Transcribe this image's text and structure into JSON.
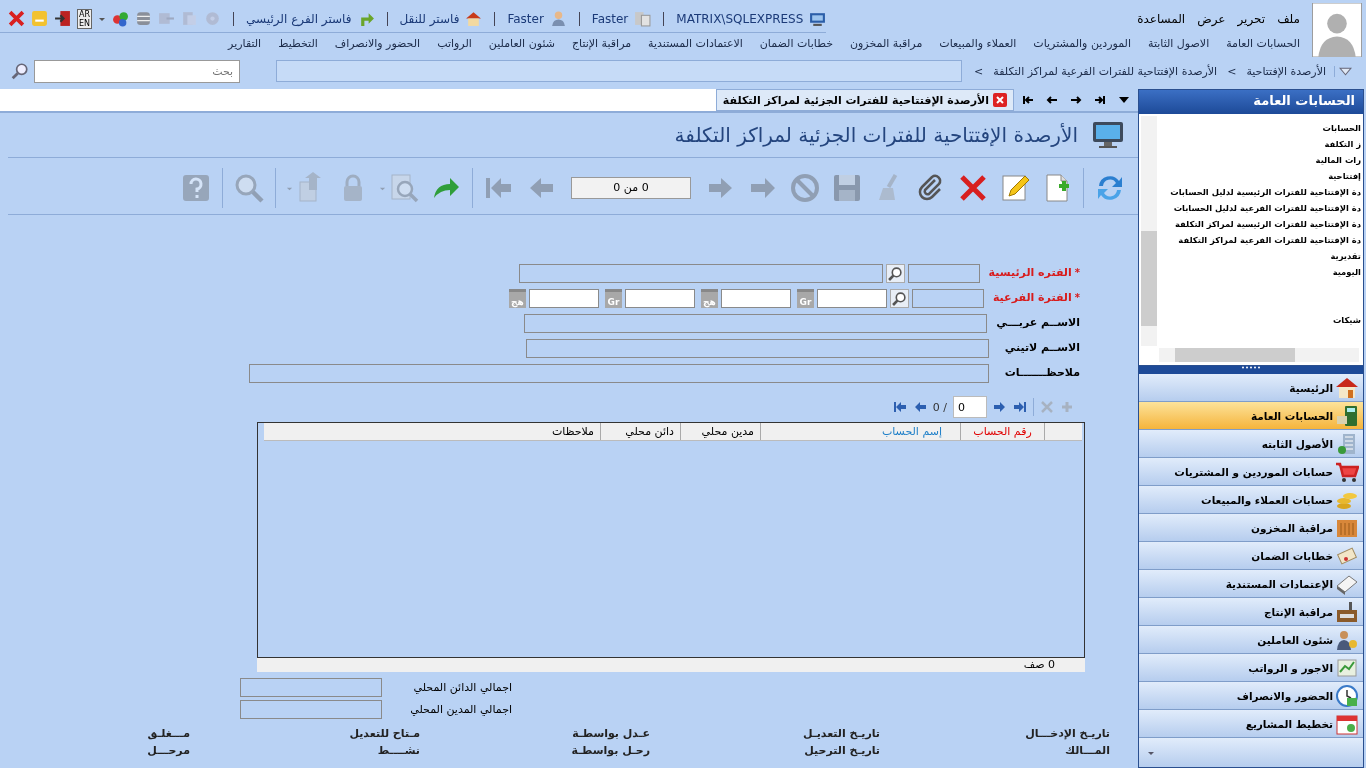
{
  "menu": [
    "ملف",
    "تحرير",
    "عرض",
    "المساعدة"
  ],
  "language": [
    "AR",
    "EN"
  ],
  "connection": [
    {
      "kind": "server",
      "label": "MATRIX\\SQLEXPRESS"
    },
    {
      "kind": "company",
      "label": "Faster"
    },
    {
      "kind": "user",
      "label": "Faster"
    },
    {
      "kind": "home",
      "label": "فاستر للنقل"
    },
    {
      "kind": "branch",
      "label": "فاستر الفرع الرئيسي"
    }
  ],
  "nav": [
    "الحسابات العامة",
    "الاصول الثابتة",
    "الموردين والمشتريات",
    "العملاء والمبيعات",
    "مراقبة المخزون",
    "خطابات الضمان",
    "الاعتمادات المستندية",
    "مراقبة الإنتاج",
    "شئون العاملين",
    "الرواتب",
    "الحضور والانصراف",
    "التخطيط",
    "التقارير"
  ],
  "breadcrumb": {
    "separator": ">",
    "items": [
      "الأرصدة الإفتتاحية",
      "الأرصدة الإفتتاحية للفترات الفرعية لمراكز التكلفة"
    ]
  },
  "search": {
    "placeholder": "بحث"
  },
  "tab": {
    "label": "الأرصدة الإفتتاحية للفترات الجزئية لمراكز التكلفة"
  },
  "form_title": "الأرصدة الإفتتاحية للفترات الجزئية لمراكز التكلفة",
  "tools": [
    {
      "kind": "refresh",
      "disabled": false
    },
    {
      "kind": "separator"
    },
    {
      "kind": "new",
      "disabled": false
    },
    {
      "kind": "edit",
      "disabled": false
    },
    {
      "kind": "delete",
      "disabled": false
    },
    {
      "kind": "attach",
      "disabled": false
    },
    {
      "kind": "clear",
      "disabled": true
    },
    {
      "kind": "save",
      "disabled": true
    },
    {
      "kind": "cancel",
      "disabled": true
    },
    {
      "kind": "last",
      "disabled": true
    },
    {
      "kind": "next",
      "disabled": true
    },
    {
      "kind": "counter",
      "label": "0 من 0"
    },
    {
      "kind": "prev",
      "disabled": true
    },
    {
      "kind": "first",
      "disabled": true
    },
    {
      "kind": "separator"
    },
    {
      "kind": "redo",
      "disabled": false
    },
    {
      "kind": "preview",
      "disabled": true
    },
    {
      "kind": "lock",
      "disabled": true
    },
    {
      "kind": "export",
      "disabled": true
    },
    {
      "kind": "separator"
    },
    {
      "kind": "find",
      "disabled": true
    },
    {
      "kind": "separator"
    },
    {
      "kind": "help",
      "disabled": true
    }
  ],
  "required_mark": "*",
  "fields": [
    {
      "kind": "lookup",
      "label": "الفتره الرئيسية",
      "required": true
    },
    {
      "kind": "dates",
      "label": "الفترة الفرعية",
      "required": true,
      "dates": [
        {
          "badge": "Gr"
        },
        {
          "badge": "هج"
        },
        {
          "badge": "Gr"
        },
        {
          "badge": "هج"
        }
      ]
    },
    {
      "kind": "text",
      "label": "الاســم عربـــي",
      "required": false
    },
    {
      "kind": "text",
      "label": "الاســم لاتيني",
      "required": false
    },
    {
      "kind": "wide",
      "label": "ملاحظـــــــات",
      "required": false
    }
  ],
  "pager": {
    "value": "0",
    "total": "/ 0"
  },
  "grid": {
    "columns": [
      {
        "label": "رقم الحساب",
        "color": "#e00000"
      },
      {
        "label": "إسم الحساب",
        "color": "#1e7fc8"
      },
      {
        "label": "مدين محلي",
        "color": "#000000"
      },
      {
        "label": "دائن محلي",
        "color": "#000000"
      },
      {
        "label": "ملاحظات",
        "color": "#000000"
      }
    ],
    "footer": "0 صف"
  },
  "totals": [
    "اجمالي الدائن المحلي",
    "اجمالي المدين المحلي"
  ],
  "audit": [
    [
      "تاريـخ الإدخـــال",
      "تاريـخ التعديـل",
      "عـدل بواسطـة",
      "مـتاح للتعديل",
      "مـــغلـق"
    ],
    [
      "المـــالك",
      "تاريـخ الترحيل",
      "رحـل بواسطـة",
      "نشــــط",
      "مرحـــل"
    ]
  ],
  "sidebar": {
    "title": "الحسابات العامة",
    "tree": [
      "الحسابات",
      "ز التكلفة",
      "رات المالية",
      "إفتتاحية",
      "دة الإفتتاحية للفترات الرئيسية لدليل الحسابات",
      "دة الإفتتاحية للفترات الفرعية لدليل الحسابات",
      "دة الإفتتاحية للفترات الرئيسية لمراكز التكلفة",
      "دة الإفتتاحية للفترات الفرعية لمراكز التكلفة",
      "تقديرية",
      "اليومية",
      "شيكات"
    ],
    "modules": [
      {
        "kind": "house",
        "label": "الرئيسية",
        "selected": false
      },
      {
        "kind": "calculator",
        "label": "الحسابات العامة",
        "selected": true
      },
      {
        "kind": "building",
        "label": "الأصول الثابته",
        "selected": false
      },
      {
        "kind": "cart",
        "label": "حسابات الموردين و المشتريات",
        "selected": false
      },
      {
        "kind": "coins",
        "label": "حسابات العملاء والمبيعات",
        "selected": false
      },
      {
        "kind": "crate",
        "label": "مراقبة المخزون",
        "selected": false
      },
      {
        "kind": "scroll",
        "label": "خطابات الضمان",
        "selected": false
      },
      {
        "kind": "book",
        "label": "الإعتمادات المستندية",
        "selected": false
      },
      {
        "kind": "factory",
        "label": "مراقبة الإنتاج",
        "selected": false
      },
      {
        "kind": "people",
        "label": "شئون العاملين",
        "selected": false
      },
      {
        "kind": "chart",
        "label": "الاجور و الرواتب",
        "selected": false
      },
      {
        "kind": "clock",
        "label": "الحضور والانصراف",
        "selected": false
      },
      {
        "kind": "calendar",
        "label": "تخطيط المشاريع",
        "selected": false
      }
    ]
  }
}
